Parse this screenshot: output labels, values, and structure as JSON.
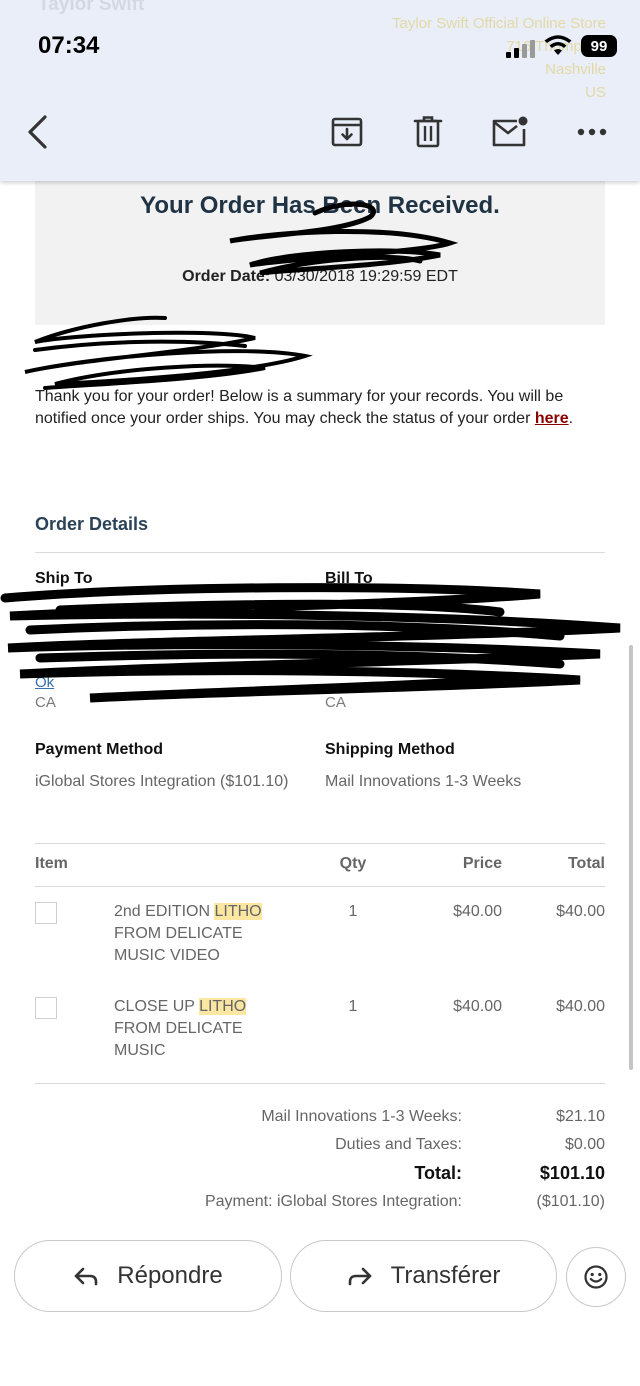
{
  "status_bar": {
    "time": "07:34",
    "battery": "99"
  },
  "background_text": {
    "sender_name": "Taylor Swift",
    "store_lines": [
      "Taylor Swift Official Online Store",
      "716 Thompson",
      "Nashville",
      "US"
    ]
  },
  "toolbar": {
    "back_icon": "chevron-left-icon",
    "archive_icon": "archive-icon",
    "delete_icon": "trash-icon",
    "mark_unread_icon": "mail-unread-icon",
    "more_icon": "more-horizontal-icon"
  },
  "email": {
    "title": "Your Order Has Been Received.",
    "order_date_label": "Order Date:",
    "order_date_value": "03/30/2018 19:29:59 EDT",
    "intro_text": "Thank you for your order! Below is a summary for your records. You will be notified once your order ships. You may check the status of your order",
    "intro_link": "here",
    "intro_end": ".",
    "order_details_title": "Order Details",
    "ship_to_label": "Ship To",
    "bill_to_label": "Bill To",
    "ship_to_country": "CA",
    "bill_to_country": "CA",
    "payment_method_label": "Payment Method",
    "payment_method_value": "iGlobal Stores Integration ($101.10)",
    "shipping_method_label": "Shipping Method",
    "shipping_method_value": "Mail Innovations 1-3 Weeks",
    "table_headers": {
      "item": "Item",
      "qty": "Qty",
      "price": "Price",
      "total": "Total"
    },
    "items": [
      {
        "name_before": "2nd EDITION ",
        "name_highlight": "LITHO",
        "name_after": " FROM DELICATE MUSIC VIDEO",
        "qty": "1",
        "price": "$40.00",
        "total": "$40.00"
      },
      {
        "name_before": "CLOSE UP ",
        "name_highlight": "LITHO",
        "name_after": " FROM DELICATE MUSIC",
        "qty": "1",
        "price": "$40.00",
        "total": "$40.00"
      }
    ],
    "summary": [
      {
        "label": "Mail Innovations 1-3 Weeks:",
        "value": "$21.10"
      },
      {
        "label": "Duties and Taxes:",
        "value": "$0.00"
      },
      {
        "label": "Total:",
        "value": "$101.10"
      },
      {
        "label": "Payment: iGlobal Stores Integration:",
        "value": "($101.10)"
      }
    ]
  },
  "actions": {
    "reply_label": "Répondre",
    "forward_label": "Transférer",
    "emoji_icon": "emoji-smile-icon"
  },
  "colors": {
    "toolbar_bg": "#e9eef8",
    "title": "#1f3345",
    "link": "#8a0000",
    "highlight": "#fbe7a1"
  }
}
